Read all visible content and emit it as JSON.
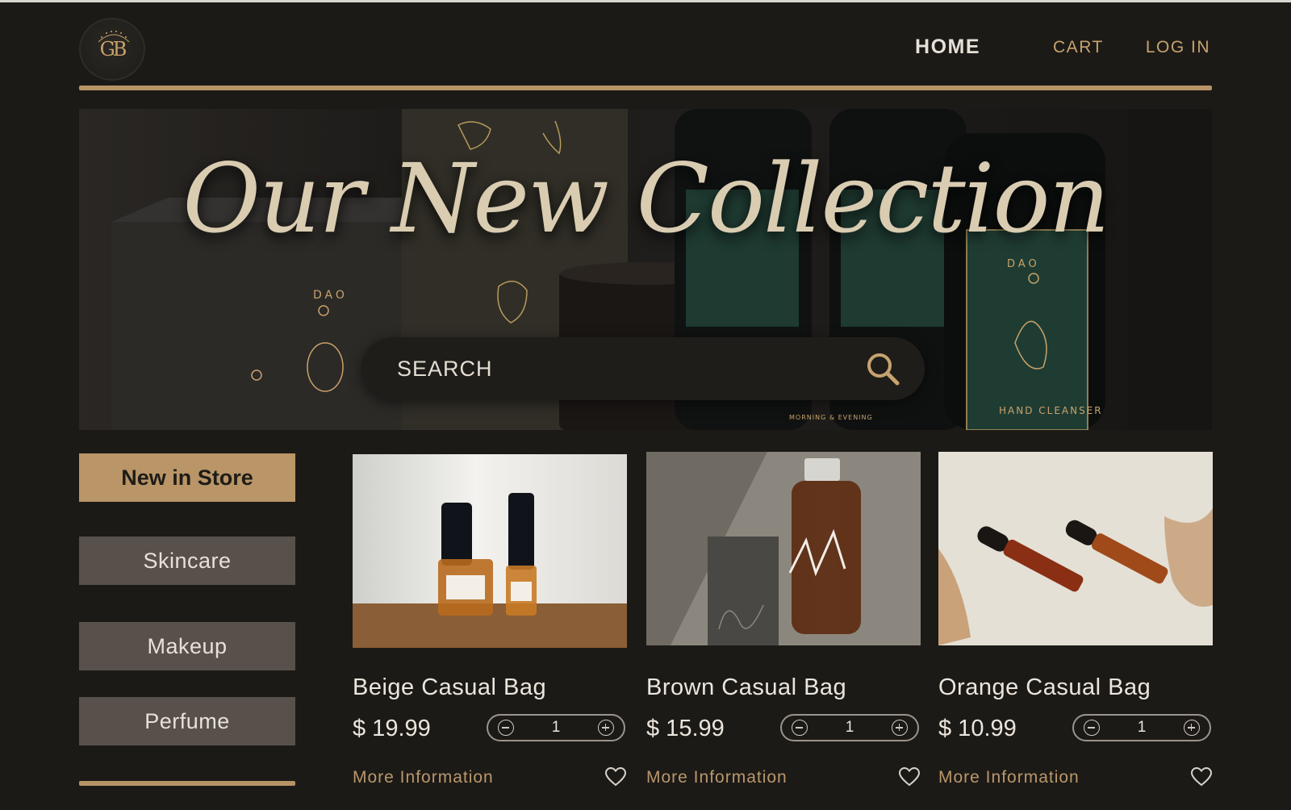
{
  "header": {
    "logo_monogram": "GB",
    "logo_ring_text": "GOODBUY",
    "nav": {
      "home": "HOME",
      "cart": "CART",
      "login": "LOG IN"
    }
  },
  "hero": {
    "title": "Our New Collection",
    "search_placeholder": "SEARCH",
    "labels": {
      "brand": "DAO",
      "bottle_label": "HAND CLEANSER",
      "jar_label": "MORNING & EVENING"
    }
  },
  "sidebar": {
    "items": [
      {
        "label": "New in Store",
        "active": true
      },
      {
        "label": "Skincare",
        "active": false
      },
      {
        "label": "Makeup",
        "active": false
      },
      {
        "label": "Perfume",
        "active": false
      }
    ]
  },
  "products": [
    {
      "name": "Beige Casual Bag",
      "price": "$ 19.99",
      "quantity": "1",
      "more_info": "More Information"
    },
    {
      "name": "Brown Casual Bag",
      "price": "$ 15.99",
      "quantity": "1",
      "more_info": "More Information"
    },
    {
      "name": "Orange Casual Bag",
      "price": "$ 10.99",
      "quantity": "1",
      "more_info": "More Information"
    }
  ],
  "colors": {
    "background": "#1c1a17",
    "accent_gold": "#b99567",
    "sidebar_button": "#58514b",
    "text_light": "#ebe5dc"
  }
}
